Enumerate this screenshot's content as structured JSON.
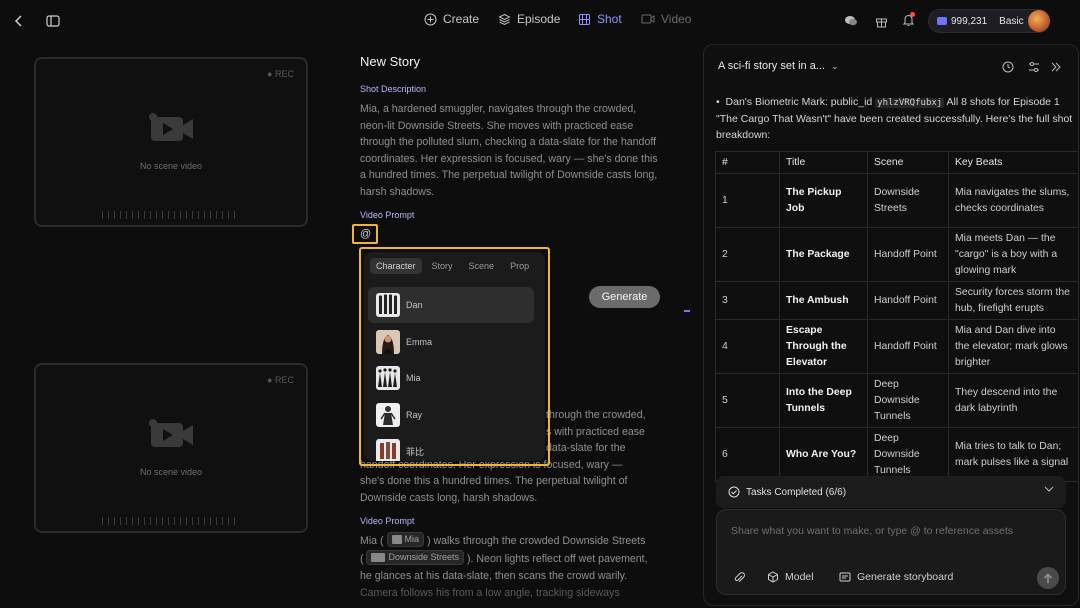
{
  "topbar": {
    "nav": [
      {
        "label": "Create",
        "icon": "plus-circle-icon"
      },
      {
        "label": "Episode",
        "icon": "layers-icon"
      },
      {
        "label": "Shot",
        "icon": "film-grid-icon",
        "active": true
      },
      {
        "label": "Video",
        "icon": "video-icon",
        "disabled": true
      }
    ],
    "credits": "999,231",
    "plan": "Basic"
  },
  "previews": {
    "rec_label": "REC",
    "empty_label": "No scene video"
  },
  "story": {
    "title": "New Story",
    "shot_description_label": "Shot Description",
    "shot_description": "Mia, a hardened smuggler, navigates through the crowded, neon-lit Downside Streets. She moves with practiced ease through the polluted slum, checking a data-slate for the handoff coordinates. Her expression is focused, wary — she's done this a hundred times. The perpetual twilight of Downside casts long, harsh shadows.",
    "video_prompt_label": "Video Prompt",
    "video_prompt_value": "@",
    "generate_label": "Generate",
    "second_description_line1": "through the crowded,",
    "second_description_line2": "s with practiced ease",
    "second_description_line3": "data-slate for the",
    "second_description_line4": "handoff coordinates. Her expression is focused, wary —",
    "second_description_line5": "she's done this a hundred times. The perpetual twilight of",
    "second_description_line6": "Downside casts long, harsh shadows.",
    "second_video_prompt_label": "Video Prompt",
    "mention_prefix": "Mia (",
    "mention_character": "Mia",
    "mention_text1": ") walks through the crowded Downside Streets",
    "mention_paren": "(",
    "mention_scene": "Downside Streets",
    "mention_text2": "). Neon lights reflect off wet pavement,",
    "mention_text3": "he glances at his data-slate, then scans the crowd warily.",
    "mention_text4": "Camera follows his from a low angle, tracking sideways"
  },
  "mention_popup": {
    "tabs": [
      "Character",
      "Story",
      "Scene",
      "Prop"
    ],
    "active_tab": "Character",
    "items": [
      "Dan",
      "Emma",
      "Mia",
      "Ray",
      "菲比"
    ]
  },
  "chat": {
    "title": "A sci-fi story set in a...",
    "message_prefix": "Dan's Biometric Mark: public_id",
    "message_code": "yhlzVRQfubxj",
    "message_suffix": "All 8 shots for Episode 1 \"The Cargo That Wasn't\" have been created successfully. Here's the full shot breakdown:",
    "table": {
      "headers": [
        "#",
        "Title",
        "Scene",
        "Key Beats"
      ],
      "rows": [
        [
          "1",
          "The Pickup Job",
          "Downside Streets",
          "Mia navigates the slums, checks coordinates"
        ],
        [
          "2",
          "The Package",
          "Handoff Point",
          "Mia meets Dan — the \"cargo\" is a boy with a glowing mark"
        ],
        [
          "3",
          "The Ambush",
          "Handoff Point",
          "Security forces storm the hub, firefight erupts"
        ],
        [
          "4",
          "Escape Through the Elevator",
          "Handoff Point",
          "Mia and Dan dive into the elevator; mark glows brighter"
        ],
        [
          "5",
          "Into the Deep Tunnels",
          "Deep Downside Tunnels",
          "They descend into the dark labyrinth"
        ],
        [
          "6",
          "Who Are You?",
          "Deep Downside Tunnels",
          "Mia tries to talk to Dan; mark pulses like a signal"
        ]
      ]
    },
    "tasks_label": "Tasks Completed (6/6)",
    "composer_placeholder": "Share what you want to make, or type @ to reference assets",
    "model_label": "Model",
    "storyboard_label": "Generate storyboard"
  },
  "colors": {
    "accent": "#8d93ff",
    "highlight": "#f0b43a"
  }
}
